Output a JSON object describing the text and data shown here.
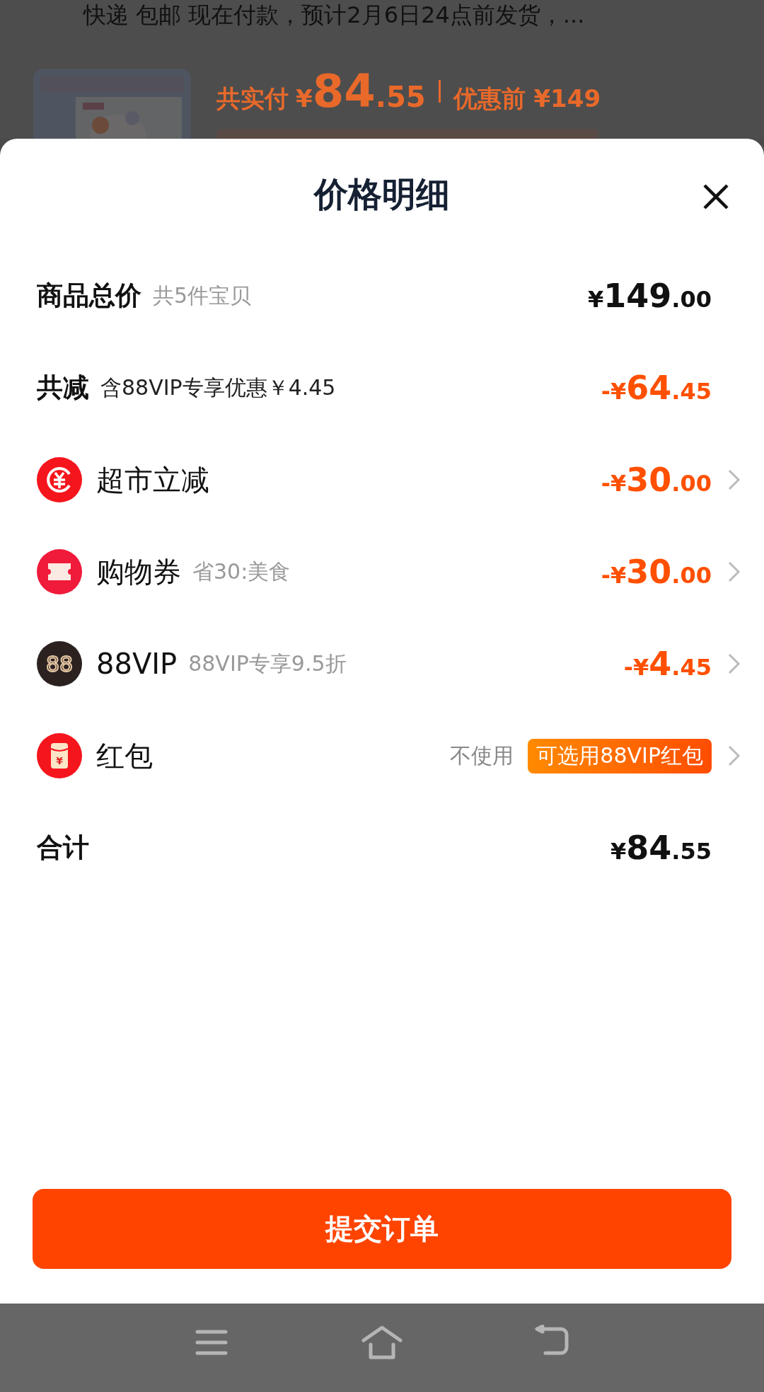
{
  "background": {
    "shipping_text": "快递 包邮 现在付款，预计2月6日24点前发货，...",
    "paid_label": "共实付",
    "paid_currency": "¥",
    "paid_integer": "84",
    "paid_decimal": ".55",
    "before_label": "优惠前 ¥149"
  },
  "sheet": {
    "title": "价格明细",
    "rows": [
      {
        "kind": "subtotal",
        "label": "商品总价",
        "note": "共5件宝贝",
        "sign": "¥",
        "integer": "149",
        "decimal": ".00",
        "highlight": false,
        "chevron": false
      },
      {
        "kind": "discount_total",
        "label": "共减",
        "note": "含88VIP专享优惠￥4.45",
        "sign": "-¥",
        "integer": "64",
        "decimal": ".45",
        "highlight": true,
        "chevron": false
      },
      {
        "kind": "rebate",
        "label": "超市立减",
        "sign": "-¥",
        "integer": "30",
        "decimal": ".00",
        "highlight": true,
        "chevron": true
      },
      {
        "kind": "coupon",
        "label": "购物券",
        "note": "省30:美食",
        "sign": "-¥",
        "integer": "30",
        "decimal": ".00",
        "highlight": true,
        "chevron": true
      },
      {
        "kind": "vip",
        "icon_text": "88",
        "label": "88VIP",
        "note": "88VIP专享9.5折",
        "sign": "-¥",
        "integer": "4",
        "decimal": ".45",
        "highlight": true,
        "chevron": true
      },
      {
        "kind": "packet",
        "icon_text": "¥",
        "label": "红包",
        "option": "不使用",
        "badge": "可选用88VIP红包",
        "chevron": true
      },
      {
        "kind": "total",
        "label": "合计",
        "sign": "¥",
        "integer": "84",
        "decimal": ".55",
        "highlight": false,
        "chevron": false
      }
    ],
    "submit": "提交订单"
  }
}
